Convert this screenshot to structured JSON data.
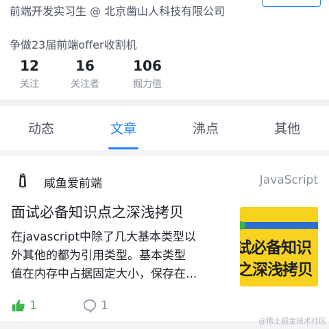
{
  "profile": {
    "job": "前端开发实习生 @ 北京凿山人科技有限公司",
    "bio": "争做23届前端offer收割机",
    "stats": [
      {
        "value": "12",
        "label": "关注"
      },
      {
        "value": "16",
        "label": "关注者"
      },
      {
        "value": "106",
        "label": "掘力值"
      }
    ]
  },
  "tabs": [
    {
      "label": "动态",
      "active": false
    },
    {
      "label": "文章",
      "active": true
    },
    {
      "label": "沸点",
      "active": false
    },
    {
      "label": "其他",
      "active": false
    }
  ],
  "article": {
    "author": "咸鱼爱前端",
    "tag": "JavaScript",
    "title": "面试必备知识点之深浅拷贝",
    "summary_lines": [
      "在javascript中除了几大基本类型以",
      "外其他的都为引用类型。基本类型",
      "值在内存中占据固定大小，保存在..."
    ],
    "thumbnail_lines": [
      "试必备知识",
      "之深浅拷贝"
    ],
    "likes": "1",
    "comments": "1"
  },
  "watermark": "@稀土掘金技术社区",
  "colors": {
    "accent": "#1e80ff",
    "like": "#3db54a",
    "thumb_bg": "#f8d21f"
  }
}
